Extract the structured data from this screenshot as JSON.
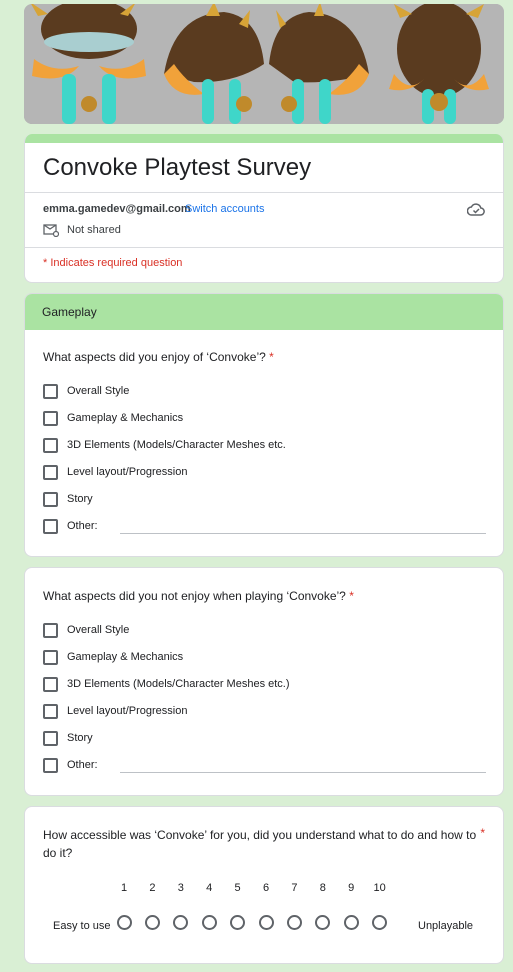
{
  "form": {
    "title": "Convoke Playtest Survey",
    "account_email": "emma.gamedev@gmail.com",
    "switch_accounts": "Switch accounts",
    "not_shared": "Not shared",
    "required_note": "* Indicates required question"
  },
  "section": {
    "title": "Gameplay"
  },
  "questions": [
    {
      "text": "What aspects did you enjoy of ‘Convoke’?",
      "required_mark": "*",
      "options": [
        "Overall Style",
        "Gameplay & Mechanics",
        "3D Elements (Models/Character Meshes etc.",
        "Level layout/Progression",
        "Story",
        "Other:"
      ]
    },
    {
      "text": "What aspects did you not enjoy when playing ‘Convoke’?",
      "required_mark": "*",
      "options": [
        "Overall Style",
        "Gameplay & Mechanics",
        "3D Elements (Models/Character Meshes etc.)",
        "Level layout/Progression",
        "Story",
        "Other:"
      ]
    },
    {
      "text": "How accessible was ‘Convoke’ for you, did you understand what to do and how to do it?",
      "required_mark": "*",
      "scale": [
        "1",
        "2",
        "3",
        "4",
        "5",
        "6",
        "7",
        "8",
        "9",
        "10"
      ],
      "low_label": "Easy to use",
      "high_label": "Unplayable"
    }
  ],
  "colors": {
    "background": "#d9efd4",
    "accent": "#aae3a2",
    "required": "#d93025",
    "link": "#1a73e8"
  },
  "icons": [
    "cloud-check-icon",
    "mail-icon"
  ]
}
